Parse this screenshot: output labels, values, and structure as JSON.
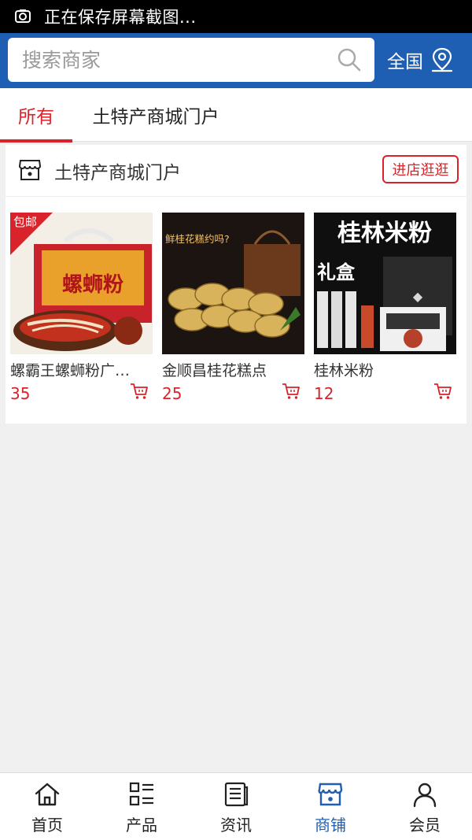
{
  "status_bar": {
    "text": "正在保存屏幕截图..."
  },
  "search": {
    "placeholder": "搜索商家"
  },
  "region": {
    "label": "全国"
  },
  "tabs": [
    {
      "label": "所有",
      "active": true
    },
    {
      "label": "土特产商城门户",
      "active": false
    }
  ],
  "shop": {
    "name": "土特产商城门户",
    "enter_label": "进店逛逛",
    "products": [
      {
        "name": "螺霸王螺蛳粉广告宣传",
        "price": "35",
        "image_text": "螺蛳粉",
        "badge": "包邮"
      },
      {
        "name": "金顺昌桂花糕点",
        "price": "25",
        "image_text": "鲜桂花糕约吗?"
      },
      {
        "name": "桂林米粉",
        "price": "12",
        "image_text": "桂林米粉",
        "image_text2": "礼盒"
      }
    ]
  },
  "bottom_nav": [
    {
      "label": "首页",
      "icon": "home-icon",
      "active": false
    },
    {
      "label": "产品",
      "icon": "grid-list-icon",
      "active": false
    },
    {
      "label": "资讯",
      "icon": "news-icon",
      "active": false
    },
    {
      "label": "商铺",
      "icon": "store-icon",
      "active": true
    },
    {
      "label": "会员",
      "icon": "user-icon",
      "active": false
    }
  ],
  "colors": {
    "brand_blue": "#1f5fb3",
    "accent_red": "#d8232a"
  }
}
